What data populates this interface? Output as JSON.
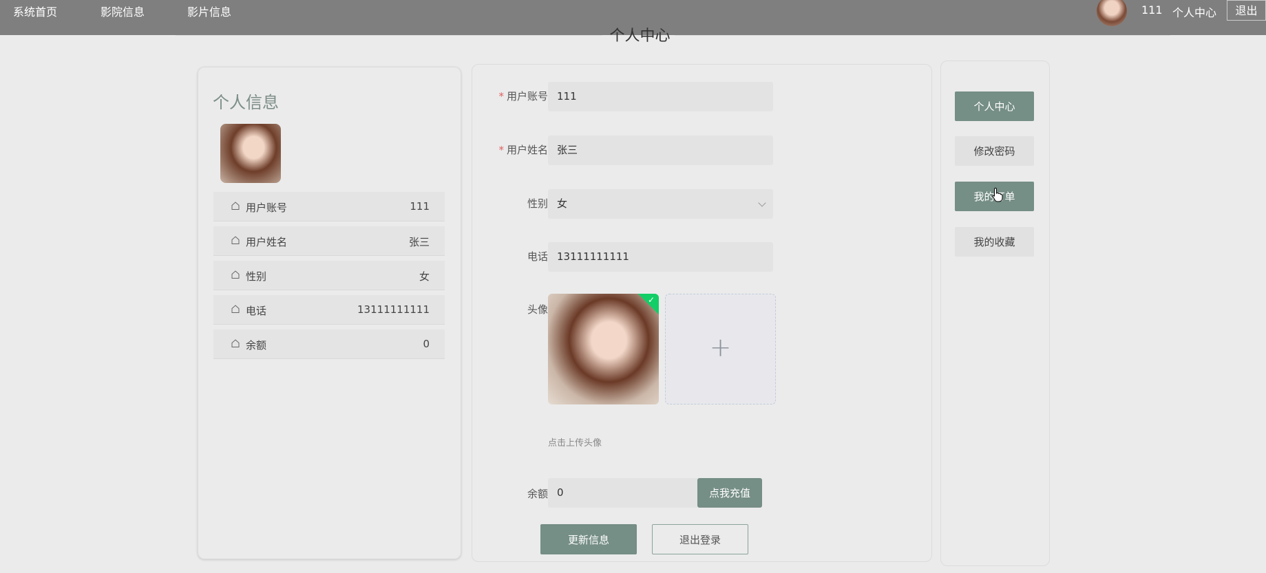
{
  "nav": {
    "items": [
      "系统首页",
      "影院信息",
      "影片信息"
    ],
    "username": "111",
    "center_label": "个人中心",
    "logout_label": "退出"
  },
  "page_title": "个人中心",
  "profile": {
    "title": "个人信息",
    "rows": [
      {
        "label": "用户账号",
        "value": "111"
      },
      {
        "label": "用户姓名",
        "value": "张三"
      },
      {
        "label": "性别",
        "value": "女"
      },
      {
        "label": "电话",
        "value": "13111111111"
      },
      {
        "label": "余额",
        "value": "0"
      }
    ]
  },
  "form": {
    "account_label": "用户账号",
    "account_value": "111",
    "name_label": "用户姓名",
    "name_value": "张三",
    "gender_label": "性别",
    "gender_value": "女",
    "phone_label": "电话",
    "phone_value": "13111111111",
    "avatar_label": "头像",
    "upload_tip": "点击上传头像",
    "balance_label": "余额",
    "balance_value": "0",
    "recharge_label": "点我充值",
    "update_label": "更新信息",
    "logout_label": "退出登录"
  },
  "side_menu": {
    "items": [
      {
        "label": "个人中心",
        "active": true
      },
      {
        "label": "修改密码",
        "active": false
      },
      {
        "label": "我的订单",
        "active": true
      },
      {
        "label": "我的收藏",
        "active": false
      }
    ]
  },
  "colors": {
    "accent": "#758e86",
    "topbar": "#7f7f7f",
    "required": "#e06060",
    "upload_success": "#13ce66"
  }
}
